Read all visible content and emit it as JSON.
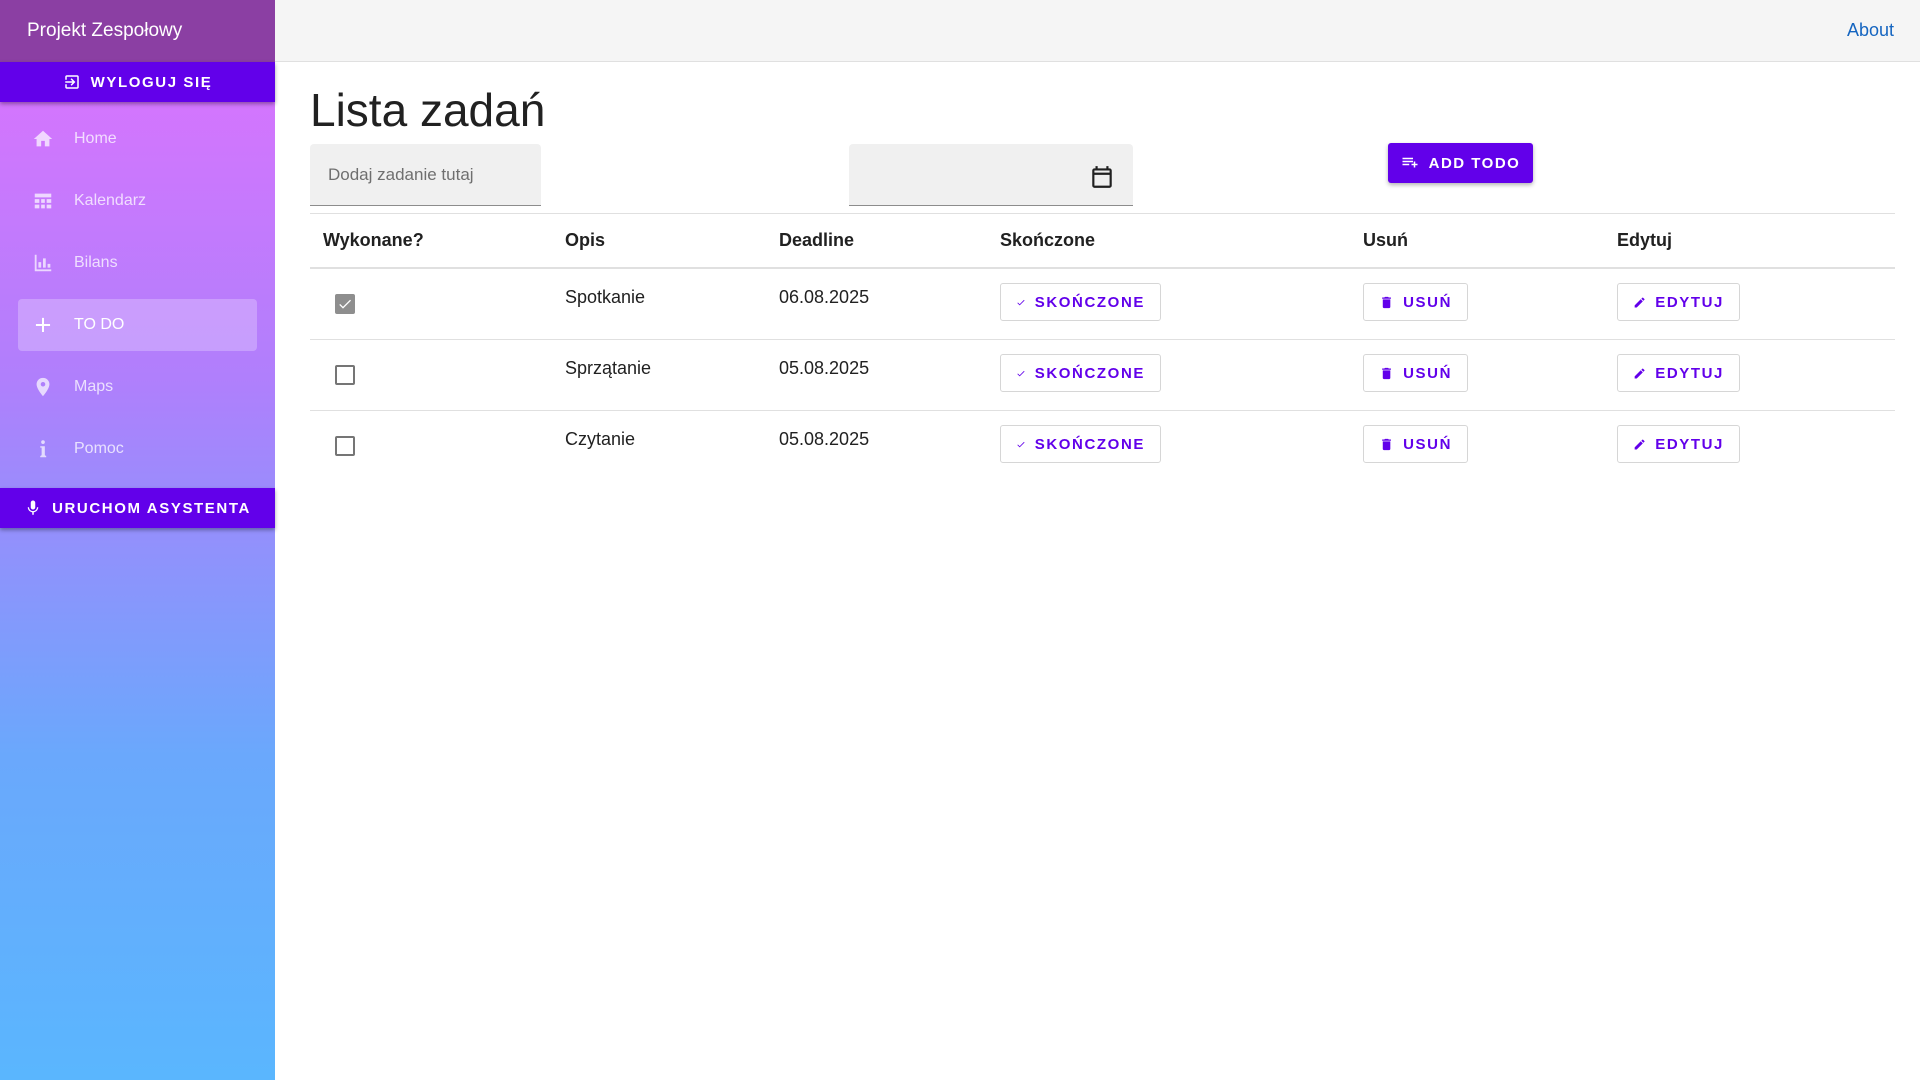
{
  "sidebar": {
    "title": "Projekt Zespołowy",
    "logout_label": "WYLOGUJ SIĘ",
    "assistant_label": "URUCHOM ASYSTENTA",
    "items": [
      {
        "label": "Home",
        "icon": "home-icon"
      },
      {
        "label": "Kalendarz",
        "icon": "calendar-grid-icon"
      },
      {
        "label": "Bilans",
        "icon": "bar-chart-icon"
      },
      {
        "label": "TO DO",
        "icon": "plus-icon",
        "active": true
      },
      {
        "label": "Maps",
        "icon": "map-pin-icon"
      },
      {
        "label": "Pomoc",
        "icon": "info-icon"
      }
    ]
  },
  "topbar": {
    "about_label": "About"
  },
  "main": {
    "title": "Lista zadań",
    "task_input_placeholder": "Dodaj zadanie tutaj",
    "date_input_value": "",
    "add_button_label": "ADD TODO"
  },
  "table": {
    "headers": {
      "done": "Wykonane?",
      "description": "Opis",
      "deadline": "Deadline",
      "finished": "Skończone",
      "delete": "Usuń",
      "edit": "Edytuj"
    },
    "rows": [
      {
        "done": true,
        "description": "Spotkanie",
        "deadline": "06.08.2025",
        "finish_label": "SKOŃCZONE",
        "delete_label": "USUŃ",
        "edit_label": "EDYTUJ"
      },
      {
        "done": false,
        "description": "Sprzątanie",
        "deadline": "05.08.2025",
        "finish_label": "SKOŃCZONE",
        "delete_label": "USUŃ",
        "edit_label": "EDYTUJ"
      },
      {
        "done": false,
        "description": "Czytanie",
        "deadline": "05.08.2025",
        "finish_label": "SKOŃCZONE",
        "delete_label": "USUŃ",
        "edit_label": "EDYTUJ"
      }
    ]
  },
  "colors": {
    "accent": "#6200ea",
    "sidebar_header": "#8b3fa3",
    "link": "#1565c0"
  }
}
